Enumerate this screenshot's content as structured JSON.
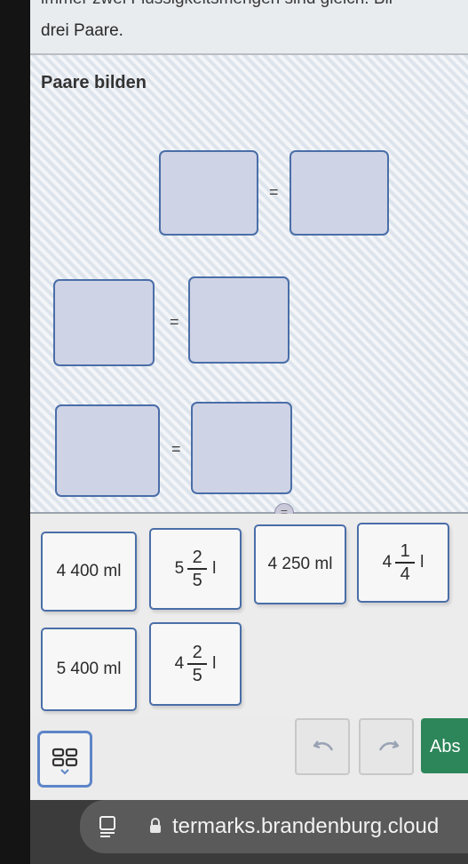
{
  "instruction": {
    "line1_partial": "immer zwei Flüssigkeitsmengen sind gleich. Bil",
    "line2": "drei Paare."
  },
  "pairs_section": {
    "title": "Paare bilden",
    "equals_sign": "="
  },
  "cards": [
    {
      "type": "text",
      "label": "4 400 ml"
    },
    {
      "type": "mixed",
      "whole": "5",
      "numerator": "2",
      "denominator": "5",
      "unit": "l"
    },
    {
      "type": "text",
      "label": "4 250 ml"
    },
    {
      "type": "mixed",
      "whole": "4",
      "numerator": "1",
      "denominator": "4",
      "unit": "l"
    },
    {
      "type": "text",
      "label": "5 400 ml"
    },
    {
      "type": "mixed",
      "whole": "4",
      "numerator": "2",
      "denominator": "5",
      "unit": "l"
    }
  ],
  "toolbar": {
    "keypad_icon": "keypad-grid-icon",
    "undo_icon": "undo-arrow-icon",
    "redo_icon": "redo-arrow-icon",
    "submit_label": "Abs"
  },
  "browser": {
    "url": "termarks.brandenburg.cloud",
    "reader_icon": "reader-mode-icon",
    "lock_icon": "lock-icon"
  },
  "colors": {
    "accent": "#4a6ea8",
    "submit": "#2d8659",
    "dropzone_fill": "#cfd3e6"
  }
}
